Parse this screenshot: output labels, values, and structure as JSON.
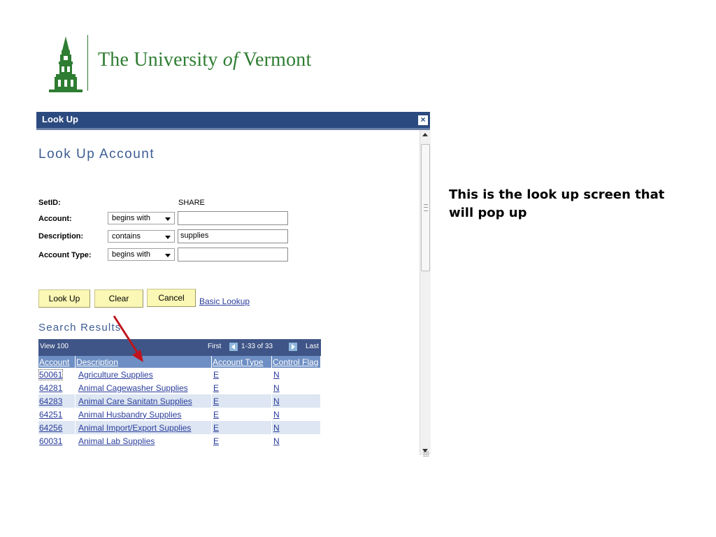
{
  "header": {
    "university_name_prefix": "The University ",
    "university_name_of": "of",
    "university_name_suffix": " Vermont",
    "brand_color": "#2e7d32"
  },
  "popup": {
    "title": "Look Up",
    "close_glyph": "×",
    "page_title": "Look Up Account",
    "form": {
      "setid_label": "SetID:",
      "setid_value": "SHARE",
      "account_label": "Account:",
      "account_operator": "begins with",
      "account_value": "",
      "description_label": "Description:",
      "description_operator": "contains",
      "description_value": "supplies",
      "account_type_label": "Account Type:",
      "account_type_operator": "begins with",
      "account_type_value": ""
    },
    "buttons": {
      "look_up": "Look Up",
      "clear": "Clear",
      "cancel": "Cancel",
      "basic_lookup": "Basic Lookup"
    },
    "results": {
      "section_title": "Search Results",
      "view_link": "View 100",
      "first_label": "First",
      "range": "1-33 of 33",
      "last_label": "Last",
      "columns": [
        "Account",
        "Description",
        "Account Type",
        "Control Flag"
      ],
      "rows": [
        {
          "account": "50061",
          "description": "Agriculture Supplies",
          "type": "E",
          "flag": "N"
        },
        {
          "account": "64281",
          "description": "Animal Cagewasher Supplies",
          "type": "E",
          "flag": "N"
        },
        {
          "account": "64283",
          "description": "Animal Care Sanitatn Supplies",
          "type": "E",
          "flag": "N"
        },
        {
          "account": "64251",
          "description": "Animal Husbandry Supplies",
          "type": "E",
          "flag": "N"
        },
        {
          "account": "64256",
          "description": "Animal Import/Export Supplies",
          "type": "E",
          "flag": "N"
        },
        {
          "account": "60031",
          "description": "Animal Lab Supplies",
          "type": "E",
          "flag": "N"
        }
      ]
    }
  },
  "caption": "This is the look up screen that will pop up",
  "colors": {
    "titlebar": "#2b4a7f",
    "heading": "#3d5d92",
    "button_bg": "#fbf7b4",
    "link": "#2a3d9c",
    "annotation_arrow": "#c0141c"
  }
}
